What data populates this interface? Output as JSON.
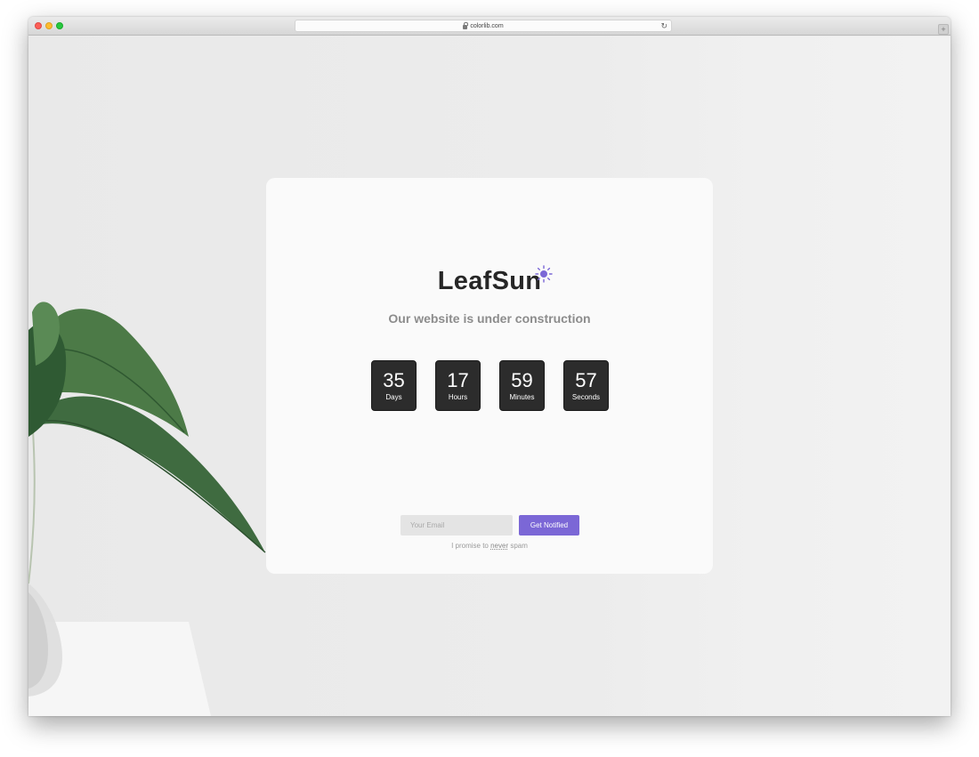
{
  "browser": {
    "url": "colorlib.com"
  },
  "brand": {
    "name": "LeafSun",
    "accent": "#7b67d6"
  },
  "tagline": "Our website is under construction",
  "countdown": [
    {
      "value": "35",
      "label": "Days"
    },
    {
      "value": "17",
      "label": "Hours"
    },
    {
      "value": "59",
      "label": "Minutes"
    },
    {
      "value": "57",
      "label": "Seconds"
    }
  ],
  "subscribe": {
    "placeholder": "Your Email",
    "button_label": "Get Notified",
    "promise_before": "I promise to ",
    "promise_emphasis": "never",
    "promise_after": " spam"
  }
}
